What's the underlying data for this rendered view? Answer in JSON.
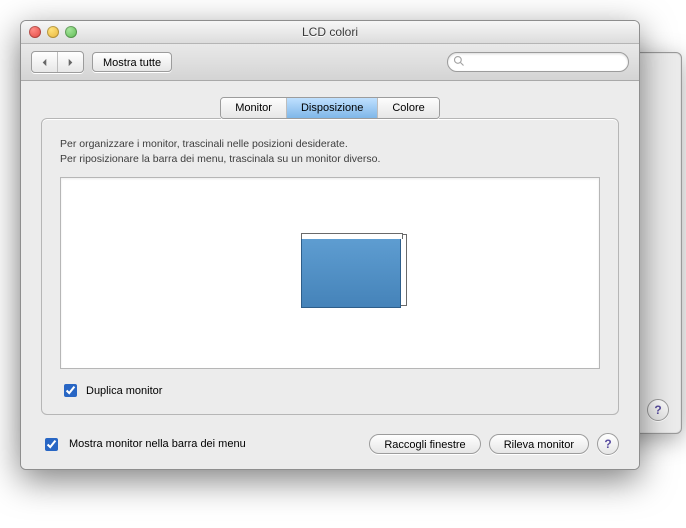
{
  "window": {
    "title": "LCD colori"
  },
  "toolbar": {
    "show_all_label": "Mostra tutte",
    "search_placeholder": ""
  },
  "tabs": [
    {
      "label": "Monitor"
    },
    {
      "label": "Disposizione"
    },
    {
      "label": "Colore"
    }
  ],
  "arrangement": {
    "line1": "Per organizzare i monitor, trascinali nelle posizioni desiderate.",
    "line2": "Per riposizionare la barra dei menu, trascinala su un monitor diverso.",
    "mirror_label": "Duplica monitor",
    "mirror_checked": true
  },
  "footer": {
    "show_in_menubar_label": "Mostra monitor nella barra dei menu",
    "show_in_menubar_checked": true,
    "gather_windows_label": "Raccogli finestre",
    "detect_displays_label": "Rileva monitor"
  },
  "help_symbol": "?"
}
